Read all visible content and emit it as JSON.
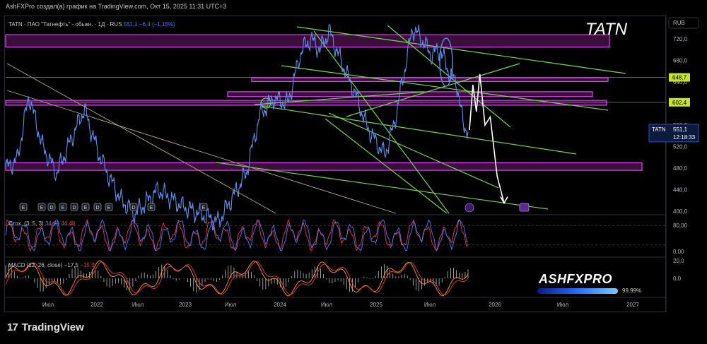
{
  "header": {
    "caption": "AshFXPro создал(а) график на TradingView.com, Окт 15, 2025 11:31 UTC+3"
  },
  "legend": {
    "symbol_line": "TATN · ПАО \"Татнефть\" - обыкн. · 1Д · RUS",
    "last_price": "551,1",
    "change": "−6,4 (−1,15%)"
  },
  "ticker_label": "TATN",
  "brand": {
    "name": "ASHFXPRO",
    "progress_label": "99.99%",
    "progress_value": 0.9999
  },
  "logo": {
    "mark": "17",
    "name": "TradingView"
  },
  "colors": {
    "price_line": "#5b8def",
    "zone_fill": "#6b1a6e",
    "zone_border": "#e040fb",
    "trendline_green": "#76d64a",
    "trendline_beige": "#b7a98c",
    "projection": "#ffffff",
    "stoch_k": "#4a7dfc",
    "stoch_d": "#f23645",
    "macd_pos": "#ffffff",
    "macd_neg": "#ffffff",
    "background": "#000000"
  },
  "price_axis": {
    "currency": "RUB",
    "ticks": [
      "720,0",
      "680,0",
      "640,0",
      "560,0",
      "520,0",
      "480,0",
      "440,0",
      "400,0"
    ],
    "markers": [
      {
        "label": "648,7",
        "color": "#c6e22a",
        "text_color": "#000000"
      },
      {
        "label": "602,4",
        "color": "#c6e22a",
        "text_color": "#000000"
      }
    ],
    "current": {
      "symbol": "TATN",
      "price": "551,1",
      "countdown": "12:18:33",
      "color": "#2962ff"
    }
  },
  "stoch": {
    "title": "Стох. (3, 5, 3)",
    "k": "34,29",
    "d": "44,48",
    "ticks": [
      "80,00",
      "0,00"
    ]
  },
  "macd": {
    "title": "MACD (12, 26, close)",
    "macd_value": "−17,5",
    "signal_value": "−15,3",
    "ticks": [
      "20,0",
      "0,0"
    ]
  },
  "time_axis": {
    "labels": [
      "Июл",
      "2022",
      "Июл",
      "2023",
      "Июл",
      "2024",
      "Июл",
      "2025",
      "Июл",
      "2026",
      "Июл",
      "2027"
    ]
  },
  "event_badges": [
    "E",
    "E",
    "D",
    "E",
    "D",
    "E",
    "D",
    "E",
    "D",
    "E",
    "E"
  ],
  "chart_data": {
    "type": "line",
    "title": "TATN · ПАО \"Татнефть\" - обыкн. · 1Д · RUS",
    "xlabel": "",
    "ylabel": "",
    "ylim": [
      400,
      740
    ],
    "x": [
      "Июл 2021",
      "2022",
      "Июл 2022",
      "2023",
      "Июл 2023",
      "2024",
      "Июл 2024",
      "2025",
      "Июл 2025",
      "Окт 2025"
    ],
    "series": [
      {
        "values": [
          470,
          545,
          420,
          395,
          410,
          600,
          735,
          640,
          565,
          551
        ],
        "path": [
          [
            0,
            480
          ],
          [
            0.025,
            495
          ],
          [
            0.05,
            615
          ],
          [
            0.08,
            520
          ],
          [
            0.11,
            470
          ],
          [
            0.14,
            530
          ],
          [
            0.17,
            590
          ],
          [
            0.2,
            510
          ],
          [
            0.22,
            470
          ],
          [
            0.25,
            420
          ],
          [
            0.28,
            395
          ],
          [
            0.33,
            440
          ],
          [
            0.38,
            410
          ],
          [
            0.42,
            395
          ],
          [
            0.46,
            380
          ],
          [
            0.52,
            470
          ],
          [
            0.55,
            580
          ],
          [
            0.58,
            610
          ],
          [
            0.61,
            600
          ],
          [
            0.64,
            700
          ],
          [
            0.66,
            720
          ],
          [
            0.68,
            700
          ],
          [
            0.7,
            735
          ],
          [
            0.72,
            690
          ],
          [
            0.74,
            650
          ],
          [
            0.76,
            610
          ],
          [
            0.78,
            560
          ],
          [
            0.8,
            530
          ],
          [
            0.82,
            505
          ],
          [
            0.84,
            560
          ],
          [
            0.86,
            650
          ],
          [
            0.88,
            740
          ],
          [
            0.9,
            720
          ],
          [
            0.92,
            690
          ],
          [
            0.94,
            700
          ],
          [
            0.96,
            655
          ],
          [
            0.975,
            640
          ],
          [
            0.99,
            560
          ],
          [
            1.0,
            551
          ]
        ]
      }
    ],
    "projection": [
      [
        0,
        551
      ],
      [
        0.1,
        635
      ],
      [
        0.2,
        585
      ],
      [
        0.3,
        655
      ],
      [
        0.45,
        560
      ],
      [
        0.6,
        575
      ],
      [
        0.8,
        465
      ],
      [
        1.0,
        415
      ]
    ],
    "horizontal_zones": [
      {
        "low": 705,
        "high": 728
      },
      {
        "low": 641,
        "high": 648
      },
      {
        "low": 613,
        "high": 622
      },
      {
        "low": 597,
        "high": 606
      },
      {
        "low": 476,
        "high": 490
      }
    ],
    "indicators": {
      "stochastic": {
        "k": 34.29,
        "d": 44.48,
        "levels": [
          80,
          20
        ]
      },
      "macd": {
        "macd": -17.5,
        "signal": -15.3
      }
    }
  }
}
